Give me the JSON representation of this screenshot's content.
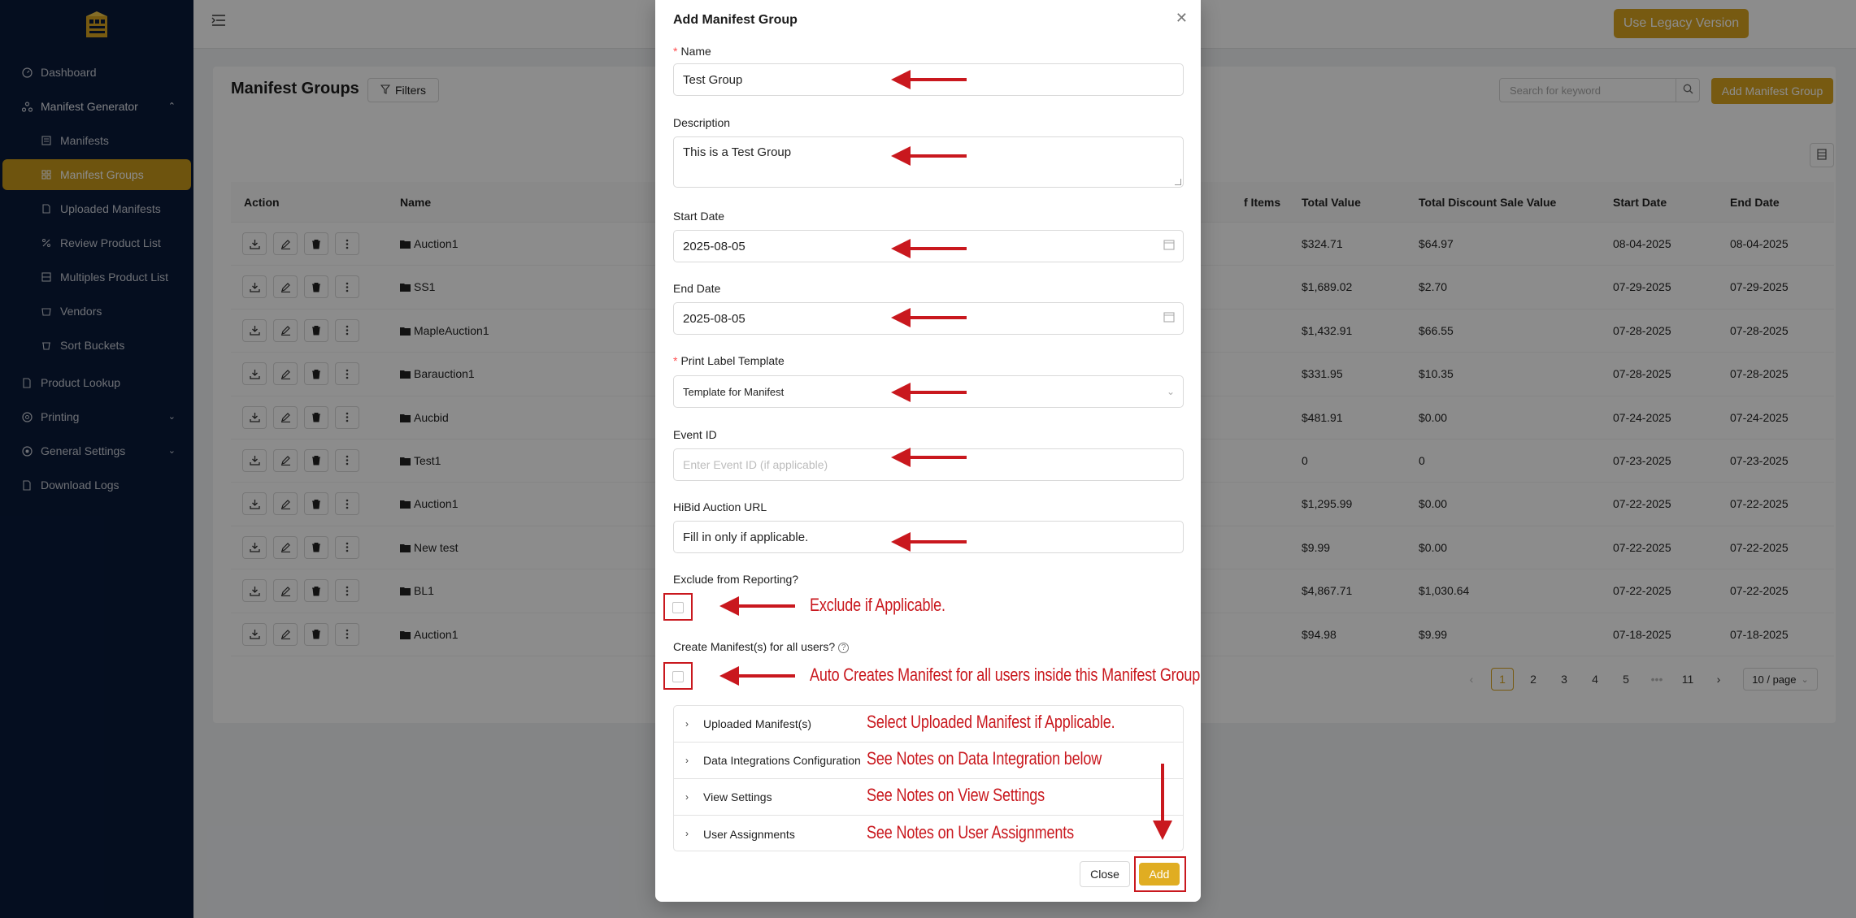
{
  "sidebar": {
    "items": [
      {
        "label": "Dashboard",
        "icon": "dashboard-icon"
      },
      {
        "label": "Manifest Generator",
        "icon": "manifest-generator-icon"
      },
      {
        "label": "Manifests",
        "icon": "manifests-icon"
      },
      {
        "label": "Manifest Groups",
        "icon": "manifest-groups-icon"
      },
      {
        "label": "Uploaded Manifests",
        "icon": "uploaded-manifests-icon"
      },
      {
        "label": "Review Product List",
        "icon": "review-icon"
      },
      {
        "label": "Multiples Product List",
        "icon": "multiples-icon"
      },
      {
        "label": "Vendors",
        "icon": "vendors-icon"
      },
      {
        "label": "Sort Buckets",
        "icon": "sort-buckets-icon"
      },
      {
        "label": "Product Lookup",
        "icon": "product-lookup-icon"
      },
      {
        "label": "Printing",
        "icon": "printing-icon"
      },
      {
        "label": "General Settings",
        "icon": "general-settings-icon"
      },
      {
        "label": "Download Logs",
        "icon": "download-logs-icon"
      }
    ]
  },
  "topbar": {
    "legacy_label": "Use Legacy Version"
  },
  "page": {
    "title": "Manifest Groups",
    "filters_label": "Filters",
    "search_placeholder": "Search for keyword",
    "add_group_label": "Add Manifest Group"
  },
  "table": {
    "headers": {
      "action": "Action",
      "name": "Name",
      "items": "f Items",
      "total_value": "Total Value",
      "total_discount": "Total Discount Sale Value",
      "start_date": "Start Date",
      "end_date": "End Date"
    },
    "rows": [
      {
        "name": "Auction1",
        "total_value": "$324.71",
        "discount": "$64.97",
        "start": "08-04-2025",
        "end": "08-04-2025"
      },
      {
        "name": "SS1",
        "total_value": "$1,689.02",
        "discount": "$2.70",
        "start": "07-29-2025",
        "end": "07-29-2025"
      },
      {
        "name": "MapleAuction1",
        "total_value": "$1,432.91",
        "discount": "$66.55",
        "start": "07-28-2025",
        "end": "07-28-2025"
      },
      {
        "name": "Barauction1",
        "total_value": "$331.95",
        "discount": "$10.35",
        "start": "07-28-2025",
        "end": "07-28-2025"
      },
      {
        "name": "Aucbid",
        "total_value": "$481.91",
        "discount": "$0.00",
        "start": "07-24-2025",
        "end": "07-24-2025"
      },
      {
        "name": "Test1",
        "total_value": "0",
        "discount": "0",
        "start": "07-23-2025",
        "end": "07-23-2025"
      },
      {
        "name": "Auction1",
        "total_value": "$1,295.99",
        "discount": "$0.00",
        "start": "07-22-2025",
        "end": "07-22-2025"
      },
      {
        "name": "New test",
        "total_value": "$9.99",
        "discount": "$0.00",
        "start": "07-22-2025",
        "end": "07-22-2025"
      },
      {
        "name": "BL1",
        "total_value": "$4,867.71",
        "discount": "$1,030.64",
        "start": "07-22-2025",
        "end": "07-22-2025"
      },
      {
        "name": "Auction1",
        "total_value": "$94.98",
        "discount": "$9.99",
        "start": "07-18-2025",
        "end": "07-18-2025"
      }
    ]
  },
  "pagination": {
    "pages": [
      "1",
      "2",
      "3",
      "4",
      "5",
      "11"
    ],
    "ellipsis": "•••",
    "page_size": "10 / page",
    "current": "1"
  },
  "modal": {
    "title": "Add Manifest Group",
    "name_label": "Name",
    "name_value": "Test Group",
    "description_label": "Description",
    "description_value": "This is a Test Group",
    "start_date_label": "Start Date",
    "start_date_value": "2025-08-05",
    "end_date_label": "End Date",
    "end_date_value": "2025-08-05",
    "print_label_label": "Print Label Template",
    "print_label_value": "Template for Manifest",
    "event_id_label": "Event ID",
    "event_id_placeholder": "Enter Event ID (if applicable)",
    "hibid_label": "HiBid Auction URL",
    "hibid_value": "Fill in only if applicable.",
    "exclude_label": "Exclude from Reporting?",
    "create_manifest_label": "Create Manifest(s) for all users?",
    "help_glyph": "?",
    "sections": [
      {
        "label": "Uploaded Manifest(s)"
      },
      {
        "label": "Data Integrations Configuration"
      },
      {
        "label": "View Settings"
      },
      {
        "label": "User Assignments"
      }
    ],
    "close_label": "Close",
    "add_label": "Add"
  },
  "annotations": {
    "exclude": "Exclude if Applicable.",
    "auto_create": "Auto Creates Manifest for all users inside this Manifest Group",
    "uploaded": "Select Uploaded Manifest if Applicable.",
    "data_integration": "See Notes on Data Integration below",
    "view_settings": "See Notes on View Settings",
    "user_assignments": "See Notes on User Assignments"
  },
  "colors": {
    "sidebar_bg": "#0a1a3a",
    "accent": "#d9a520",
    "annotation_red": "#c9181e"
  }
}
